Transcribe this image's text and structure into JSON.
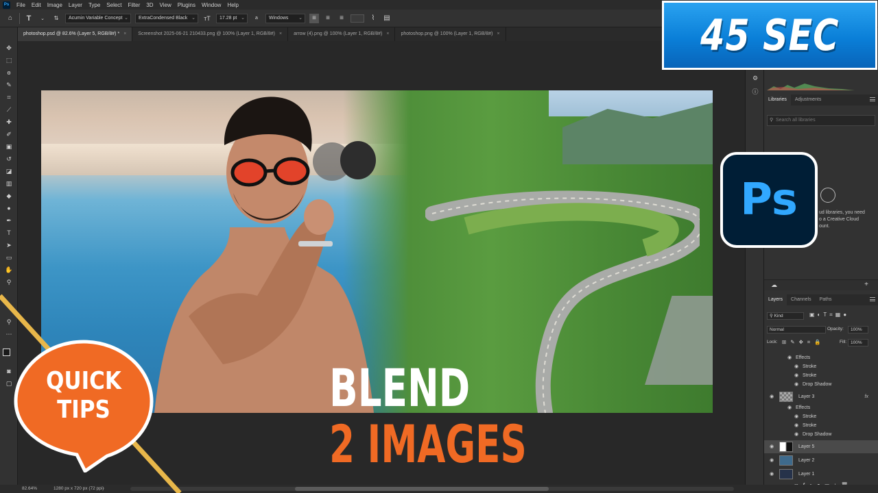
{
  "menu": {
    "app_icon": "Ps",
    "items": [
      "File",
      "Edit",
      "Image",
      "Layer",
      "Type",
      "Select",
      "Filter",
      "3D",
      "View",
      "Plugins",
      "Window",
      "Help"
    ]
  },
  "options_bar": {
    "font_family": "Acumin Variable Concept",
    "font_style": "ExtraCondensed Black",
    "font_size": "17.28 pt",
    "antialias_icon_label": "a",
    "antialias": "Windows"
  },
  "tabs": [
    {
      "label": "photoshop.psd @ 82.6% (Layer 5, RGB/8#) *",
      "active": true
    },
    {
      "label": "Screenshot 2025-06-21 210433.png @ 100% (Layer 1, RGB/8#)",
      "active": false
    },
    {
      "label": "arrow (4).png @ 100% (Layer 1, RGB/8#)",
      "active": false
    },
    {
      "label": "photoshop.png @ 100% (Layer 1, RGB/8#)",
      "active": false
    }
  ],
  "panels": {
    "libraries_tab": "Libraries",
    "adjustments_tab": "Adjustments",
    "search_placeholder": "Search all libraries",
    "libraries_msg": "ud libraries, you need\n o a Creative Cloud\n ount.",
    "layers_tab": "Layers",
    "channels_tab": "Channels",
    "paths_tab": "Paths",
    "kind": "Kind",
    "blend_mode": "Normal",
    "opacity_label": "Opacity:",
    "opacity_value": "100%",
    "lock_label": "Lock:",
    "fill_label": "Fill:",
    "fill_value": "100%",
    "layers": [
      {
        "label": "Effects",
        "level": 1
      },
      {
        "label": "Stroke",
        "level": 2
      },
      {
        "label": "Stroke",
        "level": 2
      },
      {
        "label": "Drop Shadow",
        "level": 2
      },
      {
        "label": "Layer 3",
        "level": 0,
        "fx": "fx"
      },
      {
        "label": "Effects",
        "level": 1
      },
      {
        "label": "Stroke",
        "level": 2
      },
      {
        "label": "Stroke",
        "level": 2
      },
      {
        "label": "Drop Shadow",
        "level": 2
      },
      {
        "label": "Layer 5",
        "level": 0,
        "selected": true
      },
      {
        "label": "Layer 2",
        "level": 0
      },
      {
        "label": "Layer 1",
        "level": 0
      }
    ]
  },
  "status": {
    "zoom": "82.64%",
    "doc_size": "1280 px x 720 px (72 ppi)"
  },
  "overlay": {
    "badge": "45 SEC",
    "ps_logo": "Ps",
    "title_line1": "BLEND",
    "title_line2": "2 IMAGES",
    "quick_tips_line1": "QUICK",
    "quick_tips_line2": "TIPS"
  },
  "colors": {
    "accent_orange": "#f06a24",
    "badge_blue": "#0a7fd8",
    "ps_navy": "#001e36",
    "ps_blue": "#31a8ff",
    "diag_yellow": "#e8b74a"
  }
}
